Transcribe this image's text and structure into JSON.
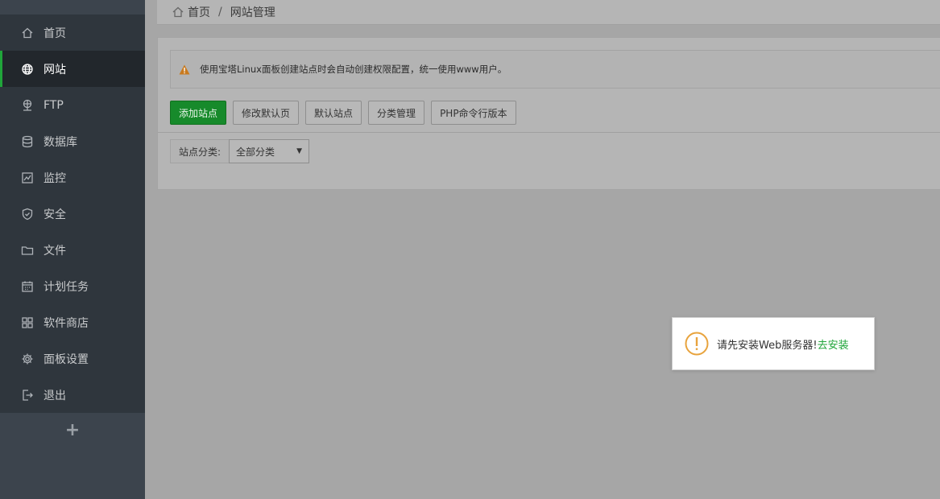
{
  "sidebar": {
    "items": [
      {
        "label": "首页",
        "icon": "home-icon"
      },
      {
        "label": "网站",
        "icon": "globe-icon",
        "active": true
      },
      {
        "label": "FTP",
        "icon": "ftp-icon"
      },
      {
        "label": "数据库",
        "icon": "database-icon"
      },
      {
        "label": "监控",
        "icon": "monitor-icon"
      },
      {
        "label": "安全",
        "icon": "shield-icon"
      },
      {
        "label": "文件",
        "icon": "folder-icon"
      },
      {
        "label": "计划任务",
        "icon": "calendar-icon"
      },
      {
        "label": "软件商店",
        "icon": "grid-icon"
      },
      {
        "label": "面板设置",
        "icon": "gear-icon"
      },
      {
        "label": "退出",
        "icon": "logout-icon"
      }
    ],
    "add_label": "+"
  },
  "breadcrumb": {
    "home": "首页",
    "separator": "/",
    "current": "网站管理"
  },
  "alert": {
    "text": "使用宝塔Linux面板创建站点时会自动创建权限配置，统一使用www用户。"
  },
  "toolbar": {
    "add_site": "添加站点",
    "edit_default_page": "修改默认页",
    "default_site": "默认站点",
    "category_manage": "分类管理",
    "php_cli_version": "PHP命令行版本"
  },
  "filter": {
    "label": "站点分类:",
    "selected": "全部分类"
  },
  "toast": {
    "message": "请先安装Web服务器!",
    "link": "去安装"
  },
  "colors": {
    "accent": "#20a53a",
    "sidebar_bg": "#2f363d",
    "warning": "#e8a33d"
  }
}
